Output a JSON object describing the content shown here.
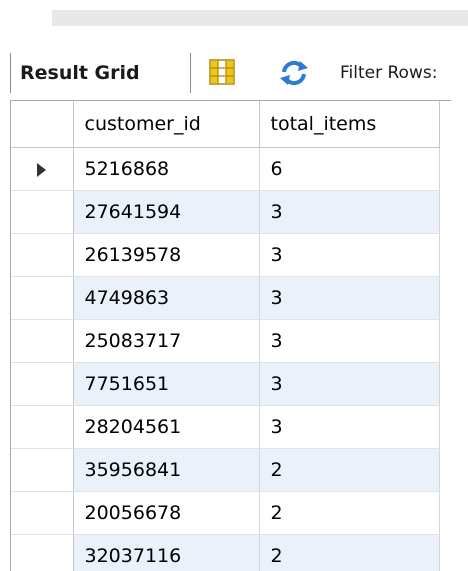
{
  "toolbar": {
    "result_grid_label": "Result Grid",
    "grid_icon": "grid-layout-icon",
    "refresh_icon": "refresh-arrows-icon",
    "filter_label": "Filter Rows:"
  },
  "colors": {
    "alt_row_bg": "#eaf1fb",
    "refresh_blue": "#2f7ad6",
    "grid_icon_yellow": "#f0c419"
  },
  "table": {
    "columns": [
      "customer_id",
      "total_items"
    ],
    "rows": [
      {
        "customer_id": "5216868",
        "total_items": "6"
      },
      {
        "customer_id": "27641594",
        "total_items": "3"
      },
      {
        "customer_id": "26139578",
        "total_items": "3"
      },
      {
        "customer_id": "4749863",
        "total_items": "3"
      },
      {
        "customer_id": "25083717",
        "total_items": "3"
      },
      {
        "customer_id": "7751651",
        "total_items": "3"
      },
      {
        "customer_id": "28204561",
        "total_items": "3"
      },
      {
        "customer_id": "35956841",
        "total_items": "2"
      },
      {
        "customer_id": "20056678",
        "total_items": "2"
      },
      {
        "customer_id": "32037116",
        "total_items": "2"
      }
    ],
    "selected_row_index": 0
  }
}
